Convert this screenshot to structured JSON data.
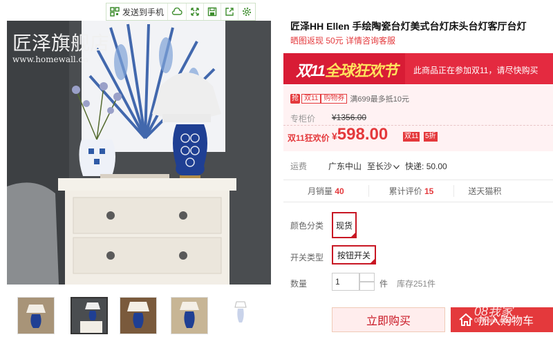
{
  "toolbar": {
    "send_to_phone": "发送到手机"
  },
  "store": {
    "name": "匠泽旗舰店",
    "url": "www.homewall.cn"
  },
  "product": {
    "title": "匠泽HH Ellen 手绘陶瓷台灯美式台灯床头台灯客厅台灯",
    "subtitle": "晒图返现 50元 详情咨询客服"
  },
  "banner": {
    "logo_a": "双11",
    "logo_b": "全球狂欢节",
    "message": "此商品正在参加双11，请尽快购买"
  },
  "price": {
    "coupon_qiang": "抢",
    "coupon_tag": "双11",
    "coupon_type": "购物券",
    "coupon_text": "满699最多抵10元",
    "original_label": "专柜价",
    "original_price": "¥1356.00",
    "sale_label": "双11狂欢价",
    "currency": "¥",
    "sale_price": "598.00",
    "tag_double11": "双11",
    "tag_discount": "5折"
  },
  "shipping": {
    "label": "运费",
    "from": "广东中山",
    "to": "至长沙",
    "method": "快递: 50.00"
  },
  "stats": {
    "monthly_label": "月销量",
    "monthly_value": "40",
    "reviews_label": "累计评价",
    "reviews_value": "15",
    "points_label": "送天猫积"
  },
  "options": {
    "color_label": "颜色分类",
    "color_value": "现货",
    "switch_label": "开关类型",
    "switch_value": "按钮开关"
  },
  "quantity": {
    "label": "数量",
    "value": "1",
    "unit": "件",
    "stock": "库存251件"
  },
  "actions": {
    "buy_now": "立即购买",
    "add_cart": "加入购物车"
  },
  "watermark": {
    "line1": "08我家",
    "line2": "08wojia.com"
  }
}
